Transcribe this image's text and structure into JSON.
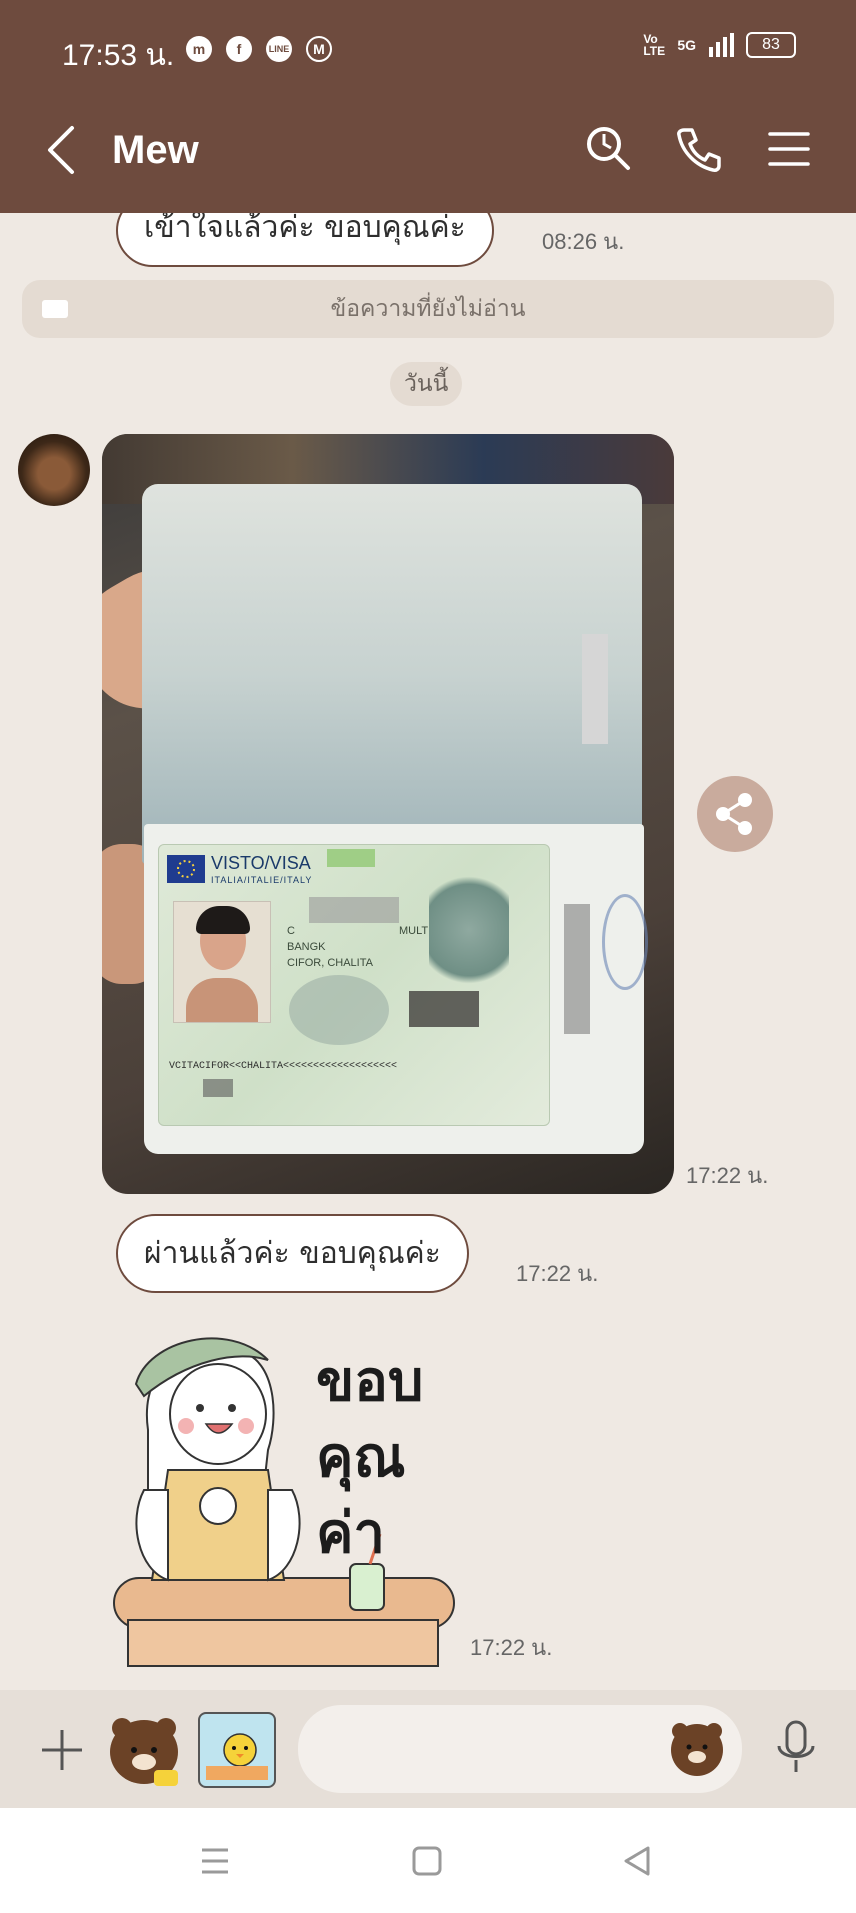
{
  "status_bar": {
    "time": "17:53 น.",
    "app_icons": [
      "messenger-icon",
      "facebook-icon",
      "line-icon",
      "gmail-icon"
    ],
    "volte": "Vo LTE",
    "network": "5G",
    "battery": "83"
  },
  "header": {
    "title": "Mew",
    "back_icon": "chevron-left-icon",
    "search_icon": "search-icon",
    "call_icon": "phone-icon",
    "menu_icon": "menu-icon"
  },
  "messages": {
    "prev_text": "เข้าใจแล้วค่ะ ขอบคุณค่ะ",
    "prev_time": "08:26 น.",
    "unread_label": "ข้อความที่ยังไม่อ่าน",
    "date_label": "วันนี้",
    "photo_time": "17:22 น.",
    "passed_text": "ผ่านแล้วค่ะ ขอบคุณค่ะ",
    "passed_time": "17:22 น.",
    "sticker_text": [
      "ขอบ",
      "คุณ",
      "ค่า"
    ],
    "sticker_time": "17:22 น."
  },
  "passport": {
    "visa_header": "VISTO/VISA",
    "country_line": "ITALIA/ITALIE/ITALY",
    "name_line": "CIFOR, CHALITA",
    "city_line": "BANGK",
    "type_line": "C",
    "entries": "MULT",
    "mrz": "VCITACIFOR<<CHALITA<<<<<<<<<<<<<<<<<<<"
  },
  "input": {
    "placeholder": ""
  },
  "colors": {
    "header_bg": "#6e4b3e",
    "chat_bg": "#efe9e3",
    "bubble_border": "#6e4b3e",
    "share_bg": "#c9ab9d"
  }
}
